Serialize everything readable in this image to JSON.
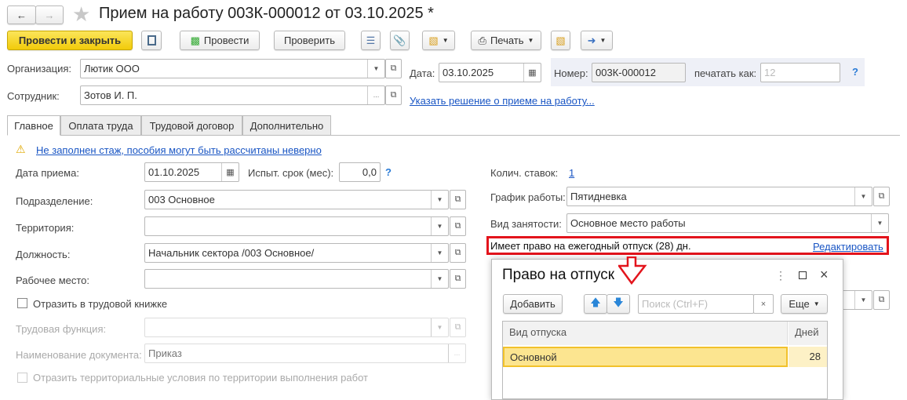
{
  "window": {
    "title": "Прием на работу 003К-000012 от 03.10.2025 *"
  },
  "toolbar": {
    "post_close": "Провести и закрыть",
    "post": "Провести",
    "check": "Проверить",
    "print": "Печать"
  },
  "header": {
    "org_label": "Организация:",
    "org_value": "Лютик ООО",
    "date_label": "Дата:",
    "date_value": "03.10.2025",
    "number_label": "Номер:",
    "number_value": "003К-000012",
    "print_as_label": "печатать как:",
    "print_as_placeholder": "12",
    "help": "?",
    "employee_label": "Сотрудник:",
    "employee_value": "Зотов И. П.",
    "decision_link": "Указать решение о приеме на работу..."
  },
  "tabs": [
    "Главное",
    "Оплата труда",
    "Трудовой договор",
    "Дополнительно"
  ],
  "main": {
    "warning": "Не заполнен стаж, пособия могут быть рассчитаны неверно",
    "hire_date_label": "Дата приема:",
    "hire_date": "01.10.2025",
    "trial_label": "Испыт. срок (мес):",
    "trial": "0,0",
    "dept_label": "Подразделение:",
    "dept": "003 Основное",
    "territory_label": "Территория:",
    "territory": "",
    "position_label": "Должность:",
    "position": "Начальник сектора /003 Основное/",
    "workplace_label": "Рабочее место:",
    "workplace": "",
    "workbook_check": "Отразить в трудовой книжке",
    "labor_func_label": "Трудовая функция:",
    "doc_name_label": "Наименование документа:",
    "doc_name": "Приказ",
    "territorial_check": "Отразить территориальные условия по территории выполнения работ",
    "rates_label": "Колич. ставок:",
    "rates": "1",
    "schedule_label": "График работы:",
    "schedule": "Пятидневка",
    "employment_label": "Вид занятости:",
    "employment": "Основное место работы",
    "vacation_text": "Имеет право на ежегодный отпуск (28) дн.",
    "edit_link": "Редактировать"
  },
  "dialog": {
    "title": "Право на отпуск",
    "add": "Добавить",
    "search_placeholder": "Поиск (Ctrl+F)",
    "more": "Еще",
    "columns": [
      "Вид отпуска",
      "Дней"
    ],
    "rows": [
      {
        "type": "Основной",
        "days": "28"
      }
    ]
  }
}
